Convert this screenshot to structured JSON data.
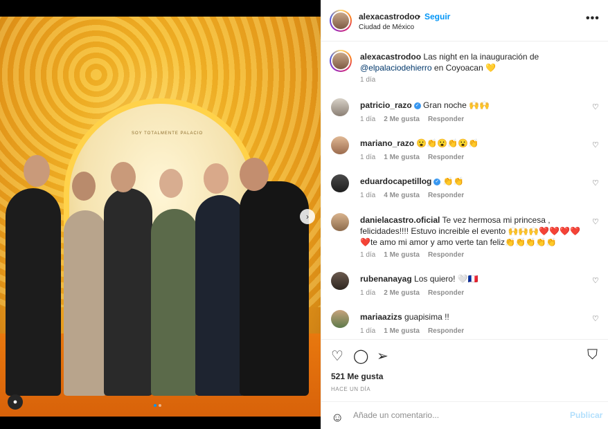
{
  "post": {
    "username": "alexacastrodoo",
    "follow_label": "Seguir",
    "location": "Ciudad de México",
    "more_icon": "more-horizontal-icon",
    "caption": {
      "username": "alexacastrodoo",
      "text_before": "Las night en la inauguración de",
      "mention": "@elpalaciodehierro",
      "text_after": "en Coyoacan 💛",
      "time": "1 día"
    },
    "photo_sign_text": "SOY TOTALMENTE PALACIO",
    "comments": [
      {
        "username": "patricio_razo",
        "verified": true,
        "text": "Gran noche 🙌🙌",
        "time": "1 día",
        "likes": "2 Me gusta",
        "reply": "Responder"
      },
      {
        "username": "mariano_razo",
        "verified": false,
        "text": "😮👏😮👏😮👏",
        "time": "1 día",
        "likes": "1 Me gusta",
        "reply": "Responder"
      },
      {
        "username": "eduardocapetillog",
        "verified": true,
        "text": "👏👏",
        "time": "1 día",
        "likes": "4 Me gusta",
        "reply": "Responder"
      },
      {
        "username": "danielacastro.oficial",
        "verified": false,
        "text": "Te vez hermosa mi princesa , felicidades!!!! Estuvo increible el evento 🙌🙌🙌❤️❤️❤️❤️❤️te amo mi amor y amo verte tan feliz👏👏👏👏👏",
        "time": "1 día",
        "likes": "1 Me gusta",
        "reply": "Responder"
      },
      {
        "username": "rubenanayag",
        "verified": false,
        "text": "Los quiero! 🤍🇫🇷",
        "time": "1 día",
        "likes": "2 Me gusta",
        "reply": "Responder"
      },
      {
        "username": "mariaazizs",
        "verified": false,
        "text": "guapisima !!",
        "time": "1 día",
        "likes": "1 Me gusta",
        "reply": "Responder"
      }
    ],
    "likes_count": "521 Me gusta",
    "posted_ago": "HACE UN DÍA",
    "add_comment_placeholder": "Añade un comentario...",
    "publish_label": "Publicar"
  },
  "colors": {
    "link_blue": "#0095f6",
    "mention_blue": "#00376b",
    "muted": "#8e8e8e",
    "publish_disabled": "#b2dffc"
  }
}
